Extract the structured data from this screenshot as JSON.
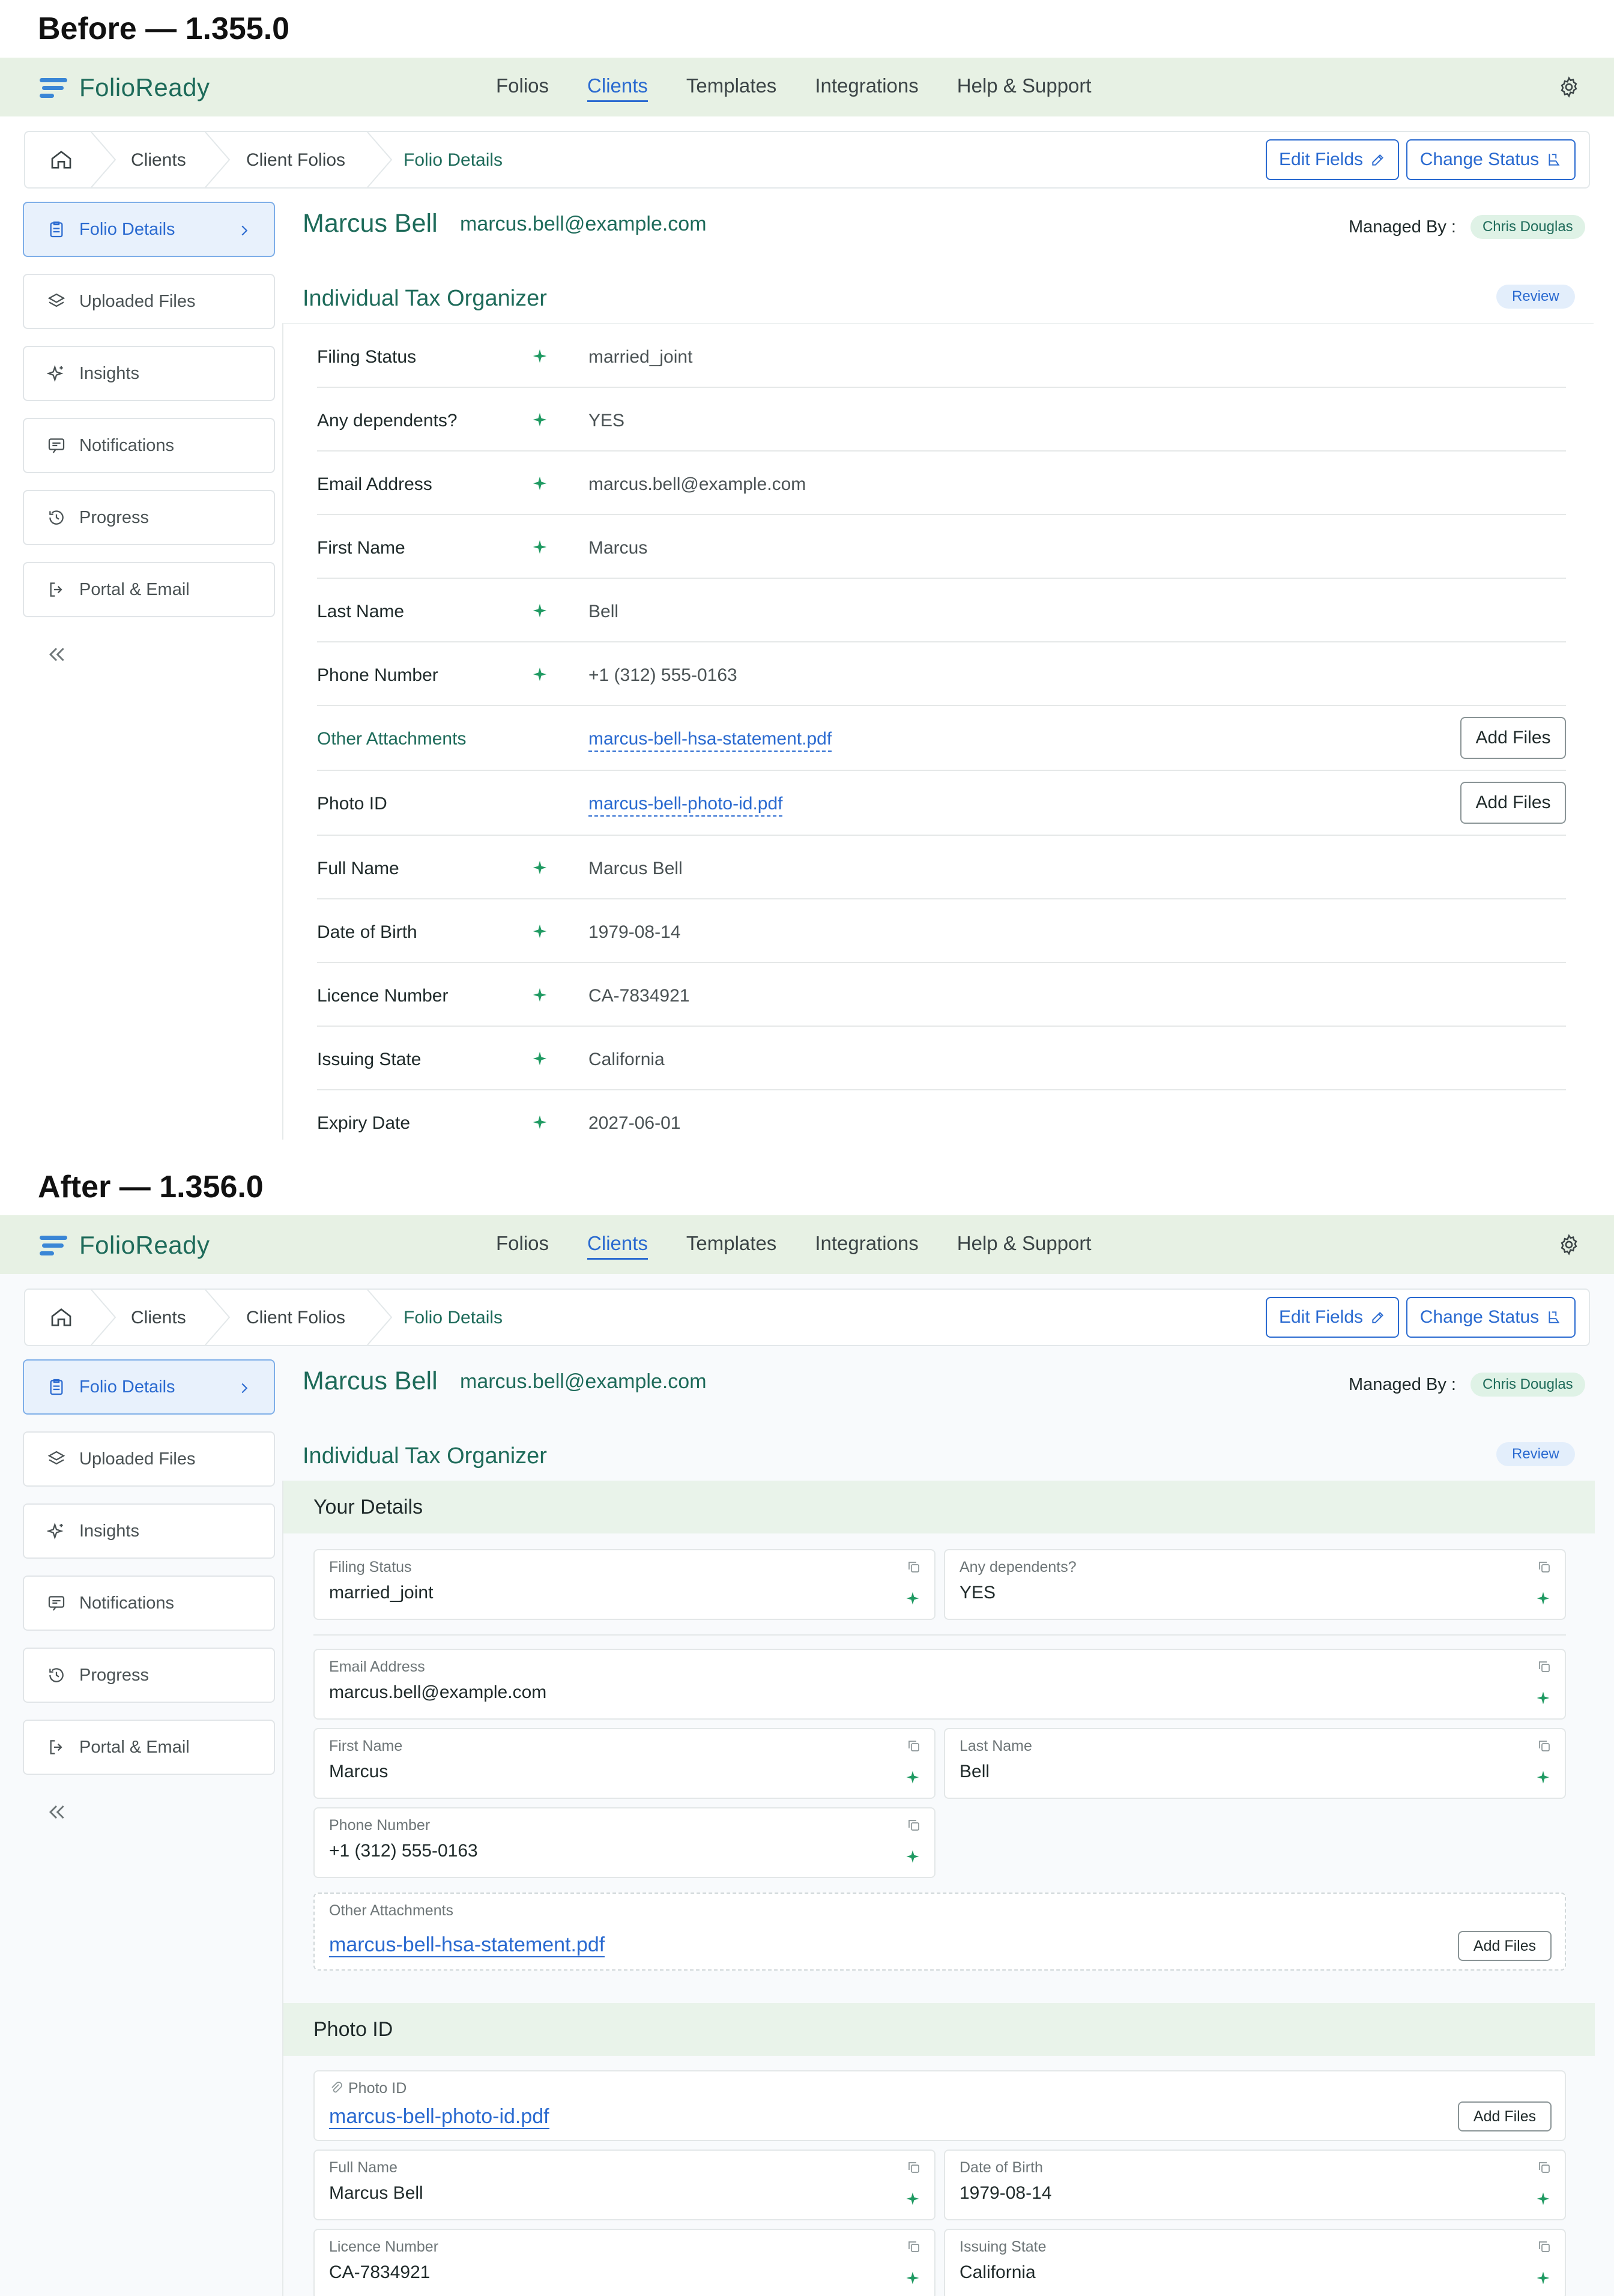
{
  "captions": {
    "before": "Before — 1.355.0",
    "after": "After — 1.356.0"
  },
  "app": {
    "name": "FolioReady"
  },
  "nav": [
    "Folios",
    "Clients",
    "Templates",
    "Integrations",
    "Help & Support"
  ],
  "nav_active": "Clients",
  "breadcrumb": [
    "Clients",
    "Client Folios",
    "Folio Details"
  ],
  "actions": {
    "edit": "Edit Fields",
    "change": "Change Status"
  },
  "sidebar": [
    "Folio Details",
    "Uploaded Files",
    "Insights",
    "Notifications",
    "Progress",
    "Portal & Email"
  ],
  "client": {
    "name": "Marcus Bell",
    "email": "marcus.bell@example.com",
    "managed_label": "Managed By :",
    "manager": "Chris Douglas"
  },
  "organizer": {
    "title": "Individual Tax Organizer",
    "status": "Review"
  },
  "before_rows": [
    {
      "label": "Filing Status",
      "value": "married_joint",
      "type": "field"
    },
    {
      "label": "Any dependents?",
      "value": "YES",
      "type": "field"
    },
    {
      "label": "Email Address",
      "value": "marcus.bell@example.com",
      "type": "field"
    },
    {
      "label": "First Name",
      "value": "Marcus",
      "type": "field"
    },
    {
      "label": "Last Name",
      "value": "Bell",
      "type": "field"
    },
    {
      "label": "Phone Number",
      "value": "+1 (312) 555-0163",
      "type": "field"
    },
    {
      "label": "Other Attachments",
      "value": "marcus-bell-hsa-statement.pdf",
      "type": "file"
    },
    {
      "label": "Photo ID",
      "value": "marcus-bell-photo-id.pdf",
      "type": "file"
    },
    {
      "label": "Full Name",
      "value": "Marcus Bell",
      "type": "field"
    },
    {
      "label": "Date of Birth",
      "value": "1979-08-14",
      "type": "field"
    },
    {
      "label": "Licence Number",
      "value": "CA-7834921",
      "type": "field"
    },
    {
      "label": "Issuing State",
      "value": "California",
      "type": "field"
    },
    {
      "label": "Expiry Date",
      "value": "2027-06-01",
      "type": "field"
    }
  ],
  "add_files": "Add Files",
  "after": {
    "section1": "Your Details",
    "section2": "Photo ID",
    "fields": {
      "filing": {
        "label": "Filing Status",
        "value": "married_joint"
      },
      "dependents": {
        "label": "Any dependents?",
        "value": "YES"
      },
      "email": {
        "label": "Email Address",
        "value": "marcus.bell@example.com"
      },
      "first": {
        "label": "First Name",
        "value": "Marcus"
      },
      "last": {
        "label": "Last Name",
        "value": "Bell"
      },
      "phone": {
        "label": "Phone Number",
        "value": "+1 (312) 555-0163"
      },
      "other": {
        "label": "Other Attachments",
        "value": "marcus-bell-hsa-statement.pdf"
      },
      "photo": {
        "label": "Photo ID",
        "value": "marcus-bell-photo-id.pdf"
      },
      "fullname": {
        "label": "Full Name",
        "value": "Marcus Bell"
      },
      "dob": {
        "label": "Date of Birth",
        "value": "1979-08-14"
      },
      "licence": {
        "label": "Licence Number",
        "value": "CA-7834921"
      },
      "state": {
        "label": "Issuing State",
        "value": "California"
      }
    }
  }
}
